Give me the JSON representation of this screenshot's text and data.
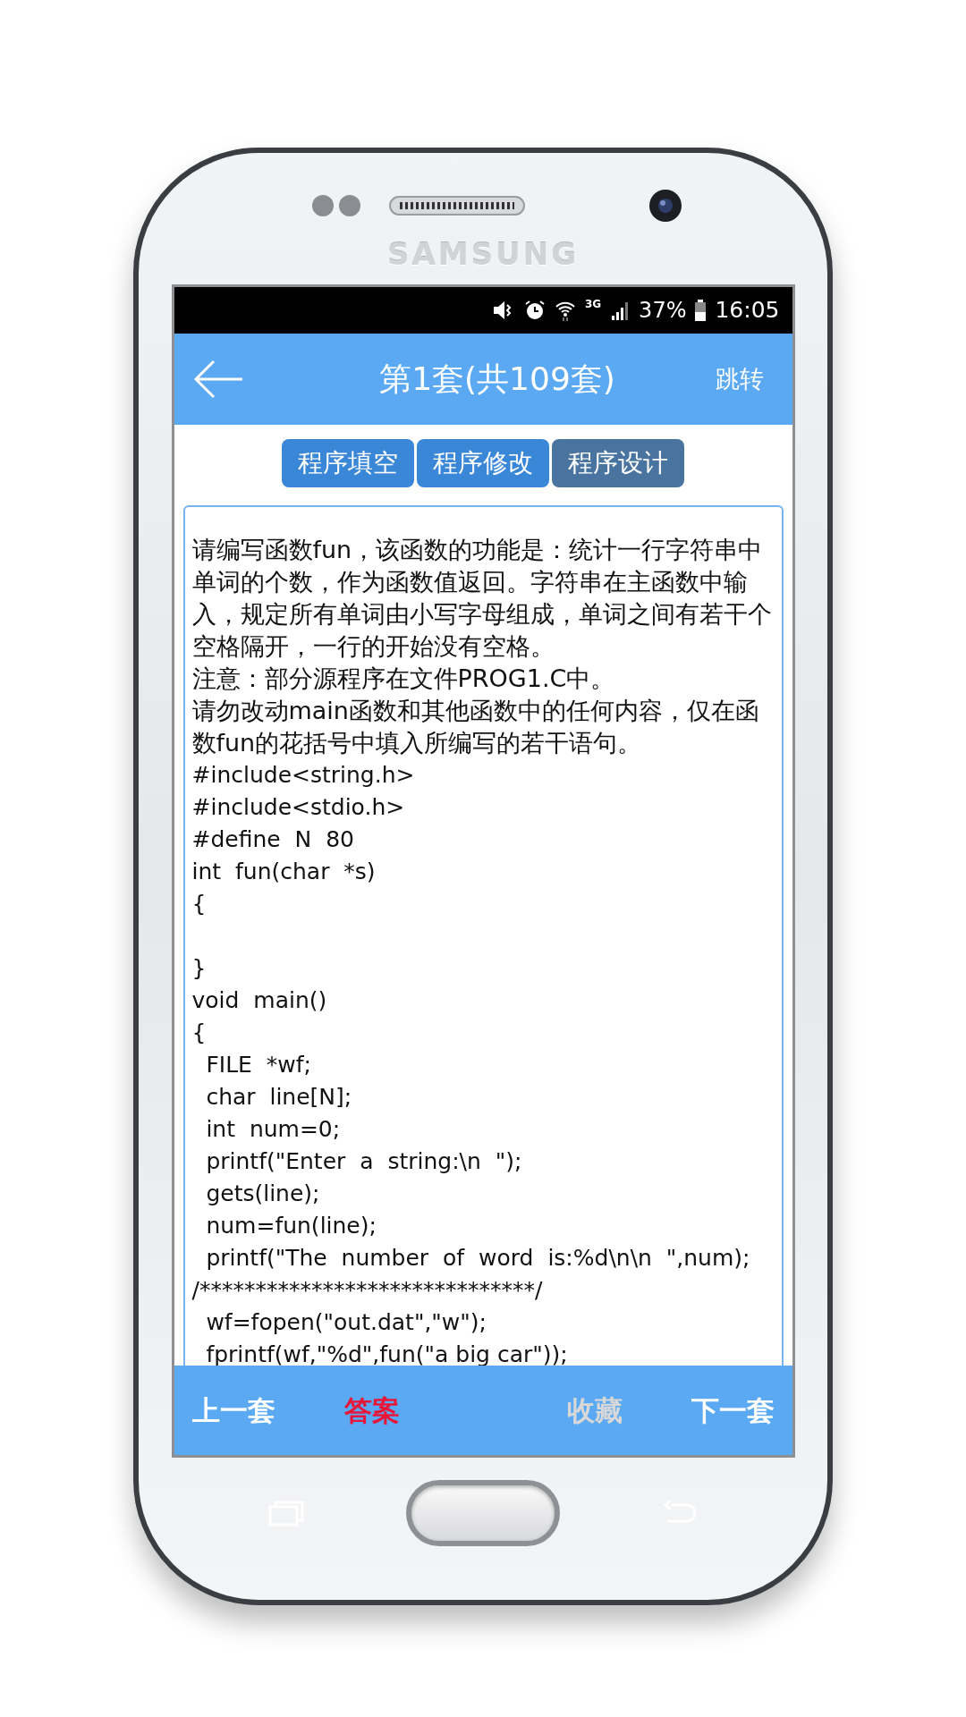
{
  "device": {
    "brand": "SAMSUNG"
  },
  "status_bar": {
    "network": "3G",
    "battery": "37%",
    "time": "16:05"
  },
  "header": {
    "title": "第1套(共109套)",
    "action": "跳转"
  },
  "tabs": [
    {
      "label": "程序填空",
      "selected": false
    },
    {
      "label": "程序修改",
      "selected": false
    },
    {
      "label": "程序设计",
      "selected": true
    }
  ],
  "question": {
    "paragraphs": [
      "请编写函数fun，该函数的功能是：统计一行字符串中单词的个数，作为函数值返回。字符串在主函数中输入，规定所有单词由小写字母组成，单词之间有若干个空格隔开，一行的开始没有空格。",
      "注意：部分源程序在文件PROG1.C中。",
      "请勿改动main函数和其他函数中的任何内容，仅在函数fun的花括号中填入所编写的若干语句。"
    ],
    "code": "#include<string.h>\n#include<stdio.h>\n#define  N  80\nint  fun(char  *s)\n{\n\n}\nvoid  main()\n{\n  FILE  *wf;\n  char  line[N];\n  int  num=0;\n  printf(\"Enter  a  string:\\n  \");\n  gets(line);\n  num=fun(line);\n  printf(\"The  number  of  word  is:%d\\n\\n  \",num);\n/******************************/\n  wf=fopen(\"out.dat\",\"w\");\n  fprintf(wf,\"%d\",fun(\"a big car\"));"
  },
  "bottom_bar": [
    {
      "label": "上一套",
      "color": "#ffffff"
    },
    {
      "label": "答案",
      "color": "#e8173a"
    },
    {
      "label": "收藏",
      "color": "#d8d8d8"
    },
    {
      "label": "下一套",
      "color": "#ffffff"
    }
  ]
}
